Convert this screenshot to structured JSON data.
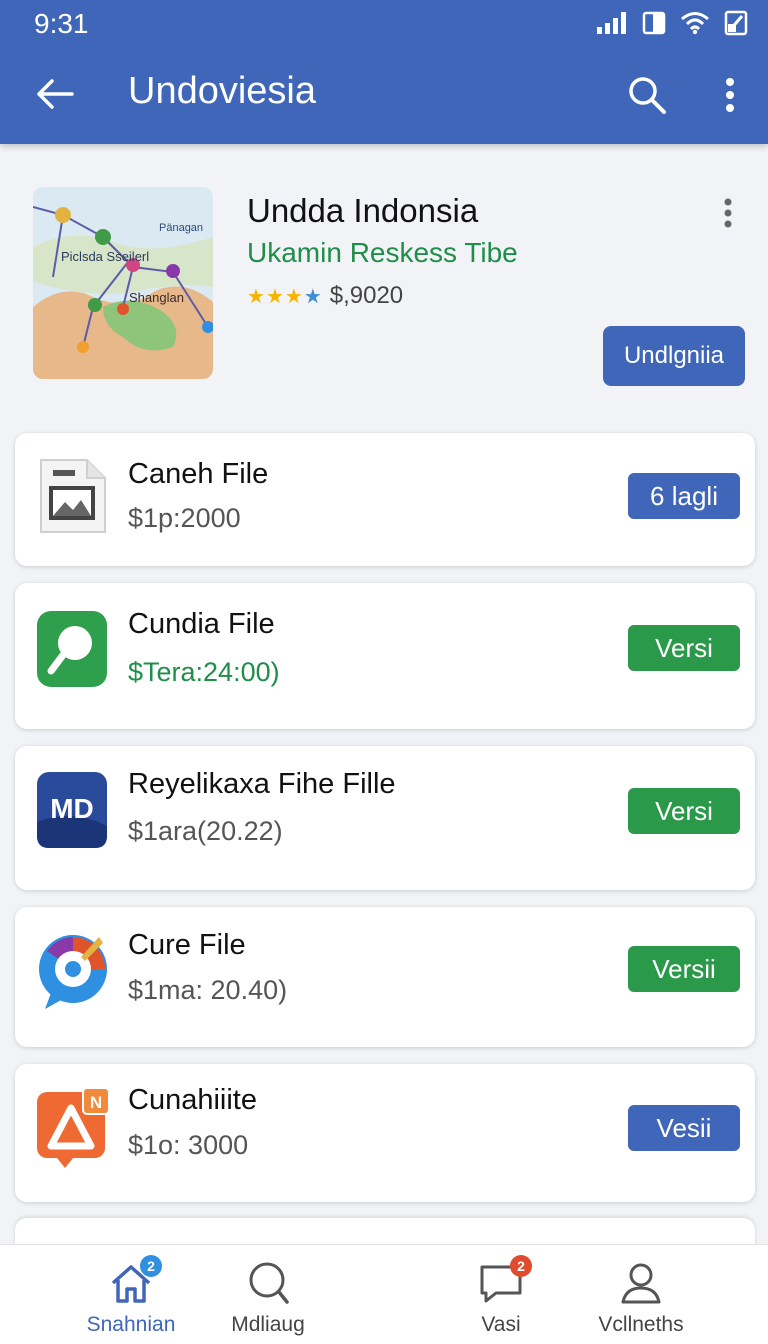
{
  "status_bar": {
    "time": "9:31"
  },
  "app_bar": {
    "title": "Undoviesia"
  },
  "hero": {
    "title": "Undda Indonsia",
    "subtitle": "Ukamin Reskess Tibe",
    "stars": 4,
    "price": "$,9020",
    "button_label": "Undlgniia",
    "map_labels": [
      "Pänagan",
      "Piclsda Sseilerl",
      "Shanglan"
    ]
  },
  "items": [
    {
      "name": "Caneh File",
      "price": "$1p:2000",
      "price_color": "gray",
      "action": "6 lagli",
      "action_color": "#3f66b8",
      "icon": "image-file-icon"
    },
    {
      "name": "Cundia File",
      "price": "$Tera:24:00)",
      "price_color": "green",
      "action": "Versi",
      "action_color": "#2a9a4a",
      "icon": "search-app-icon"
    },
    {
      "name": "Reyelikaxa Fihe Fille",
      "price": "$1ara(20.22)",
      "price_color": "gray",
      "action": "Versi",
      "action_color": "#2a9a4a",
      "icon": "md-app-icon"
    },
    {
      "name": "Cure File",
      "price": "$1ma: 20.40)",
      "price_color": "gray",
      "action": "Versii",
      "action_color": "#2a9a4a",
      "icon": "chat-bubble-app-icon"
    },
    {
      "name": "Cunahiiite",
      "price": "$1o: 3000",
      "price_color": "gray",
      "action": "Vesii",
      "action_color": "#3f66b8",
      "icon": "warning-n-app-icon"
    }
  ],
  "bottom_nav": [
    {
      "label": "Snahnian",
      "icon": "home-icon",
      "badge": "2",
      "active": true
    },
    {
      "label": "Mdliaug",
      "icon": "search-icon",
      "badge": "",
      "active": false
    },
    {
      "label": "Vasi",
      "icon": "chat-icon",
      "badge": "2",
      "active": false
    },
    {
      "label": "Vcllneths",
      "icon": "person-icon",
      "badge": "",
      "active": false
    }
  ],
  "colors": {
    "primary": "#3f66b8",
    "green": "#2a9a4a",
    "background": "#f1f3f6"
  }
}
